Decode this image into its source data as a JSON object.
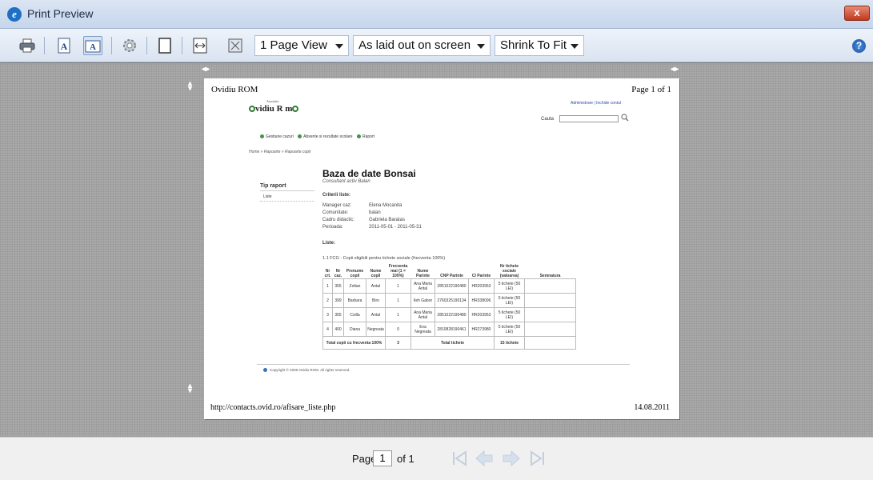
{
  "window": {
    "title": "Print Preview",
    "close_label": "x"
  },
  "toolbar": {
    "icons": [
      "print-icon",
      "portrait-icon",
      "landscape-icon",
      "page-setup-icon",
      "headers-footers-icon",
      "full-width-icon",
      "full-page-icon",
      "help-icon"
    ],
    "view_select": "1 Page View",
    "layout_select": "As laid out on screen",
    "scale_select": "Shrink To Fit",
    "help_label": "?"
  },
  "page": {
    "header_left": "Ovidiu ROM",
    "header_right": "Page 1 of 1",
    "footer_left": "http://contacts.ovid.ro/afisare_liste.php",
    "footer_right": "14.08.2011",
    "site": {
      "logo_text": "vidiu R m",
      "logo_tag": "Asociatia",
      "top_links": "Administrare  |  Inchide contul",
      "search_label": "Cauta",
      "nav": [
        "Gestiune cazuri",
        "Absente si rezultate scolare",
        "Raport"
      ],
      "breadcrumb": "Home » Rapoarte » Rapoarte copii",
      "sidebar_title": "Tip raport",
      "sidebar_item": "Liste",
      "title": "Baza de date Bonsai",
      "subtitle": "Consultant activ Balan",
      "criteria_title": "Criterii liste:",
      "criteria": [
        {
          "label": "Manager caz:",
          "value": "Elena Mocanita"
        },
        {
          "label": "Comunitate:",
          "value": "balan"
        },
        {
          "label": "Cadru didactic:",
          "value": "Gabriela Baratas"
        },
        {
          "label": "Perioada:",
          "value": "2011-05-01 - 2011-05-31"
        }
      ],
      "lists_title": "Liste:",
      "list_caption": "1.1 FCG - Copii eligibili pentru tichete sociale (frecventa 100%)",
      "table": {
        "headers": [
          "Nr crt.",
          "Nr caz.",
          "Prenume copil",
          "Nume copil",
          "Frecventa mai (1 = 100%)",
          "Nume Parinte",
          "CNP Parinte",
          "CI Parinte",
          "Nr tichete sociale (valoarea)",
          "Semnatura"
        ],
        "rows": [
          [
            "1",
            "355",
            "Zoltan",
            "Antal",
            "1",
            "Ana Maria Antal",
            "2851022190480",
            "HR203953",
            "5 tichete (50 LEI)",
            ""
          ],
          [
            "2",
            "399",
            "Barbara",
            "Biro",
            "1",
            "Ileh Gabor",
            "2760325190134",
            "HR338096",
            "5 tichete (50 LEI)",
            ""
          ],
          [
            "3",
            "355",
            "Csilla",
            "Antal",
            "1",
            "Ana Maria Antal",
            "2851022190480",
            "HR203953",
            "5 tichete (50 LEI)",
            ""
          ],
          [
            "4",
            "400",
            "Diana",
            "Negreata",
            "0",
            "Eva Negreata",
            "2810828190461",
            "HR273980",
            "5 tichete (50 LEI)",
            ""
          ]
        ],
        "total_label": "Total copii cu frecventa 100%",
        "total_value": "3",
        "total_tichete_label": "Total tichete",
        "total_tichete_value": "15 tichete"
      },
      "copyright": "Copyright © 2009 Ovidiu ROM. All rights reserved."
    }
  },
  "pager": {
    "label": "Page",
    "current": "1",
    "of_text": "of 1"
  }
}
